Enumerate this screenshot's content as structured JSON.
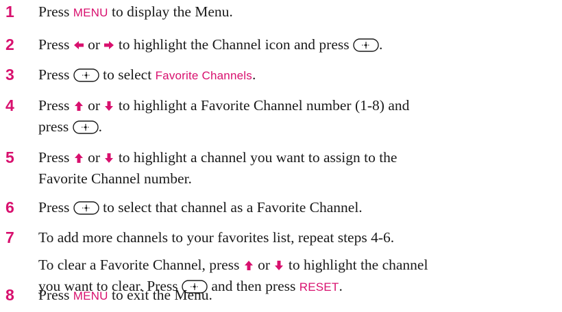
{
  "colors": {
    "accent": "#d8106e",
    "text": "#1a1a1a"
  },
  "icons": {
    "left": "left-arrow-icon",
    "right": "right-arrow-icon",
    "up": "up-arrow-icon",
    "down": "down-arrow-icon",
    "select": "select-button-icon"
  },
  "steps": [
    {
      "number": "1",
      "a": "Press",
      "key": "MENU",
      "b": "to display the Menu."
    },
    {
      "number": "2",
      "a": "Press",
      "or": "or",
      "b": "to highlight the Channel icon and press",
      "c": "."
    },
    {
      "number": "3",
      "a": "Press",
      "b": "to select",
      "key": "Favorite Channels",
      "c": "."
    },
    {
      "number": "4",
      "a": "Press",
      "or": "or",
      "b": "to highlight a Favorite Channel number (1-8) and",
      "c": "press",
      "d": "."
    },
    {
      "number": "5",
      "a": "Press",
      "or": "or",
      "b": "to highlight a channel you want to assign to the",
      "c": "Favorite Channel number."
    },
    {
      "number": "6",
      "a": "Press",
      "b": "to select that channel as a Favorite Channel."
    },
    {
      "number": "7",
      "a": "To add more channels to your favorites list, repeat steps 4-6.",
      "note_a": "To clear a Favorite Channel, press",
      "note_or": "or",
      "note_b": "to highlight the channel",
      "note_c": "you want to clear. Press",
      "note_d": "and then press",
      "note_key": "RESET",
      "note_e": "."
    },
    {
      "number": "8",
      "a": "Press",
      "key": "MENU",
      "b": "to exit the Menu."
    }
  ]
}
